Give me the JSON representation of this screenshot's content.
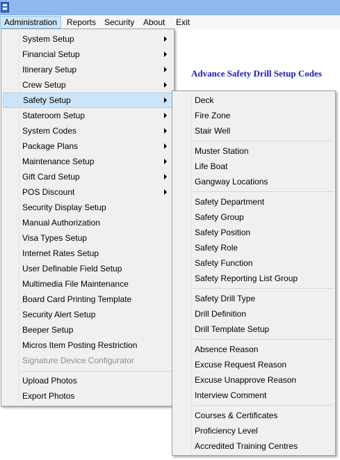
{
  "menubar": {
    "items": [
      "Administration",
      "Reports",
      "Security",
      "About",
      "Exit"
    ]
  },
  "heading": "Advance Safety Drill Setup Codes",
  "admin_menu": {
    "items": [
      {
        "label": "System Setup",
        "submenu": true
      },
      {
        "label": "Financial Setup",
        "submenu": true
      },
      {
        "label": "Itinerary Setup",
        "submenu": true
      },
      {
        "label": "Crew Setup",
        "submenu": true
      },
      {
        "label": "Safety Setup",
        "submenu": true,
        "selected": true
      },
      {
        "label": "Stateroom Setup",
        "submenu": true
      },
      {
        "label": "System Codes",
        "submenu": true
      },
      {
        "label": "Package Plans",
        "submenu": true
      },
      {
        "label": "Maintenance Setup",
        "submenu": true
      },
      {
        "label": "Gift Card Setup",
        "submenu": true
      },
      {
        "label": "POS Discount",
        "submenu": true
      },
      {
        "label": "Security Display Setup"
      },
      {
        "label": "Manual Authorization"
      },
      {
        "label": "Visa Types Setup"
      },
      {
        "label": "Internet Rates Setup"
      },
      {
        "label": "User Definable Field Setup"
      },
      {
        "label": "Multimedia File Maintenance"
      },
      {
        "label": "Board Card Printing Template"
      },
      {
        "label": "Security Alert Setup"
      },
      {
        "label": "Beeper Setup"
      },
      {
        "label": "Micros Item Posting Restriction"
      },
      {
        "label": "Signature Device Configurator",
        "disabled": true
      },
      {
        "label": "Upload Photos"
      },
      {
        "label": "Export Photos"
      }
    ]
  },
  "safety_menu": {
    "items": [
      "Deck",
      "Fire Zone",
      "Stair Well",
      "Muster Station",
      "Life Boat",
      "Gangway Locations",
      "Safety Department",
      "Safety Group",
      "Safety Position",
      "Safety Role",
      "Safety Function",
      "Safety Reporting List Group",
      "Safety Drill Type",
      "Drill Definition",
      "Drill Template Setup",
      "Absence Reason",
      "Excuse Request Reason",
      "Excuse Unapprove Reason",
      "Interview Comment",
      "Courses & Certificates",
      "Proficiency Level",
      "Accredited Training Centres"
    ]
  }
}
